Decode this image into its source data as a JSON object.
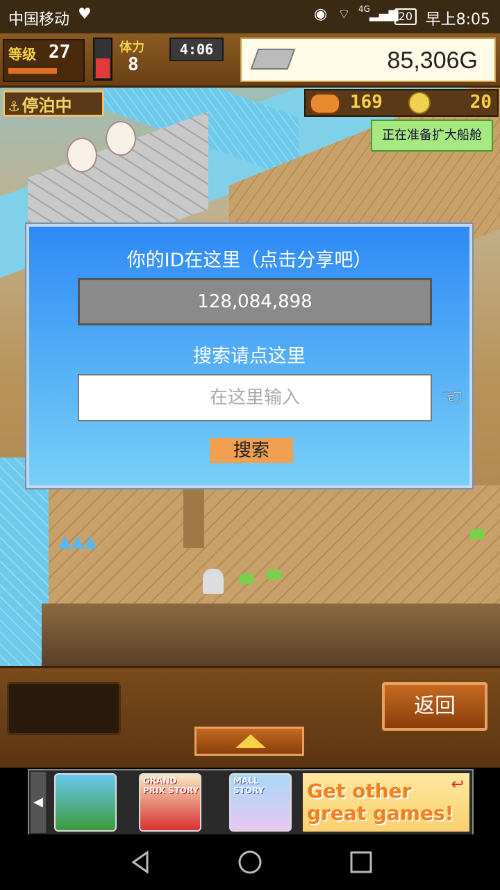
{
  "status_bar": {
    "carrier": "中国移动",
    "battery": "20",
    "network": "4G",
    "time": "早上8:05"
  },
  "hud": {
    "level_label": "等级",
    "level": "27",
    "stamina_label": "体力",
    "stamina": "8",
    "timer": "4:06",
    "gold": "85,306G"
  },
  "state": {
    "moored_label": "停泊中",
    "resource1": "169",
    "resource2": "20",
    "expand_notice": "正在准备扩大船舱"
  },
  "dialog": {
    "title": "你的ID在这里（点击分享吧）",
    "player_id": "128,084,898",
    "search_hint": "搜索请点这里",
    "input_placeholder": "在这里输入",
    "search_button": "搜索"
  },
  "bottom": {
    "back_button": "返回"
  },
  "ad": {
    "game2_title": "GRAND PRIX STORY",
    "game3_title": "MALL STORY",
    "cta": "Get other great games!"
  },
  "colors": {
    "dialog_top": "#2e8af6",
    "dialog_bottom": "#78d0f7",
    "search_button": "#f0a050",
    "expand_notice_bg": "#a8e880"
  },
  "icons": [
    "heart-icon",
    "eye-icon",
    "wifi-icon",
    "signal-icon",
    "anchor-icon",
    "silver-bar-icon",
    "cannon-icon",
    "coin-icon",
    "hand-pointer-icon",
    "up-arrow-icon",
    "nav-back-icon",
    "nav-home-icon",
    "nav-recent-icon"
  ]
}
